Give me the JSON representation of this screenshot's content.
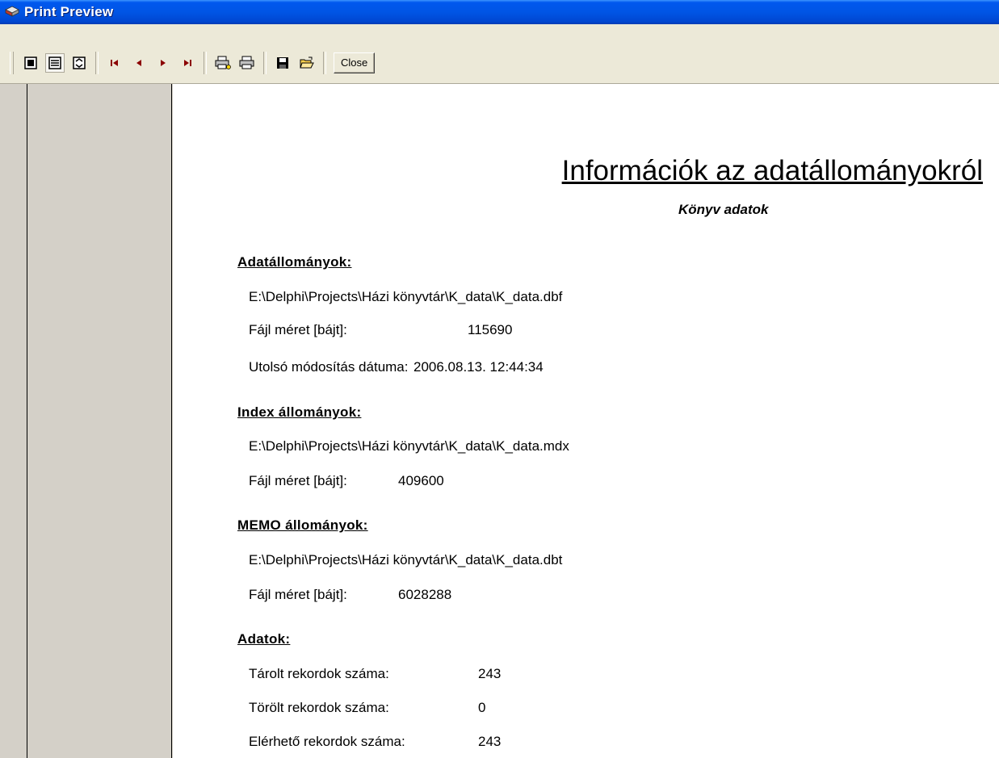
{
  "window": {
    "title": "Print Preview"
  },
  "toolbar": {
    "close_label": "Close",
    "buttons": [
      "whole-page",
      "page-width",
      "zoom-100",
      "first-page",
      "prev-page",
      "next-page",
      "last-page",
      "print-setup",
      "print",
      "save",
      "open"
    ]
  },
  "report": {
    "title": "Információk az adatállományokról",
    "subtitle": "Könyv adatok",
    "data_files": {
      "heading": "Adatállományok:",
      "path": "E:\\Delphi\\Projects\\Házi könyvtár\\K_data\\K_data.dbf",
      "size_label": "Fájl méret [bájt]:",
      "size_value": "115690",
      "modified_label": "Utolsó módosítás dátuma:",
      "modified_value": "2006.08.13. 12:44:34"
    },
    "index_files": {
      "heading": "Index állományok:",
      "path": "E:\\Delphi\\Projects\\Házi könyvtár\\K_data\\K_data.mdx",
      "size_label": "Fájl méret [bájt]:",
      "size_value": "409600"
    },
    "memo_files": {
      "heading": "MEMO állományok:",
      "path": "E:\\Delphi\\Projects\\Házi könyvtár\\K_data\\K_data.dbt",
      "size_label": "Fájl méret [bájt]:",
      "size_value": "6028288"
    },
    "records": {
      "heading": "Adatok:",
      "stored_label": "Tárolt rekordok száma:",
      "stored_value": "243",
      "deleted_label": "Törölt rekordok száma:",
      "deleted_value": "0",
      "available_label": "Elérhető rekordok száma:",
      "available_value": "243"
    }
  }
}
